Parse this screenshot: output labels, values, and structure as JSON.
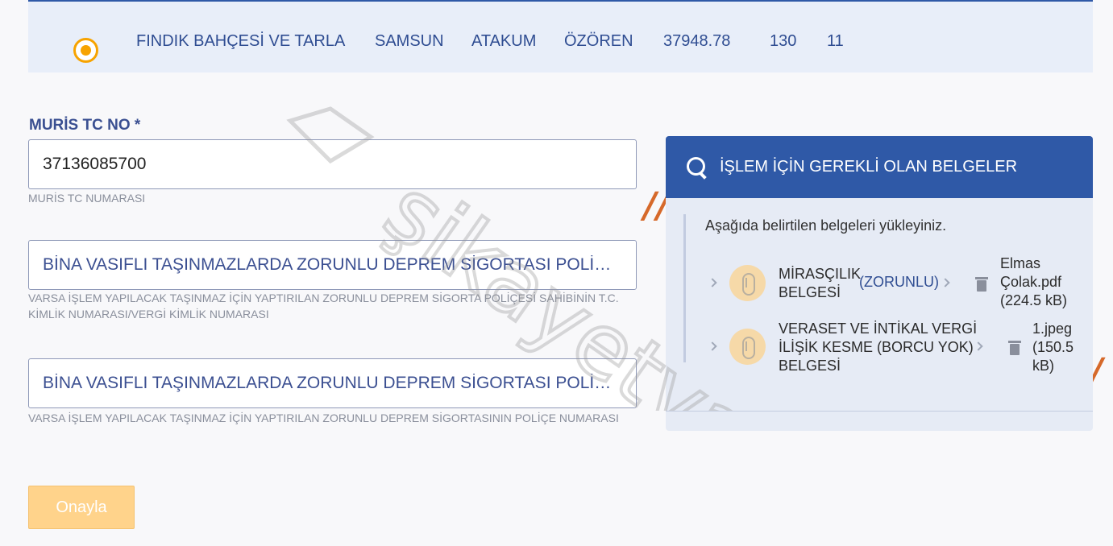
{
  "property_row": {
    "cells": [
      "FINDIK BAHÇESİ VE TARLA",
      "SAMSUN",
      "ATAKUM",
      "ÖZÖREN",
      "37948.78",
      "130",
      "11"
    ]
  },
  "fields": {
    "muris_label": "MURİS TC NO *",
    "muris_value": "37136085700",
    "muris_help": "MURİS TC NUMARASI",
    "deprem_id_placeholder": "BİNA VASIFLI TAŞINMAZLARDA ZORUNLU DEPREM SİGORTASI POLİÇE...",
    "deprem_id_help": "VARSA İŞLEM YAPILACAK TAŞINMAZ İÇİN YAPTIRILAN ZORUNLU DEPREM SİGORTA POLİÇESİ SAHİBİNİN T.C. KİMLİK NUMARASI/VERGİ KİMLİK NUMARASI",
    "deprem_no_placeholder": "BİNA VASIFLI TAŞINMAZLARDA ZORUNLU DEPREM SİGORTASI POLİÇE...",
    "deprem_no_help": "VARSA İŞLEM YAPILACAK TAŞINMAZ İÇİN YAPTIRILAN ZORUNLU DEPREM SİGORTASININ POLİÇE NUMARASI"
  },
  "actions": {
    "confirm_label": "Onayla"
  },
  "documents": {
    "title": "İŞLEM İÇİN GEREKLİ OLAN BELGELER",
    "instruction": "Aşağıda belirtilen belgeleri yükleyiniz.",
    "items": [
      {
        "name_line1": "MİRASÇILIK",
        "name_line2": "BELGESİ",
        "badge": "(ZORUNLU)",
        "file_line1": "Elmas",
        "file_line2": "Çolak.pdf",
        "file_line3": "(224.5 kB)"
      },
      {
        "name_line1": "VERASET VE İNTİKAL VERGİ",
        "name_line2": "İLİŞİK KESME (BORCU YOK)",
        "name_line3": "BELGESİ",
        "file_line1": "1.jpeg",
        "file_line2": "(150.5",
        "file_line3": "kB)"
      }
    ]
  },
  "watermark": "şikayetvar",
  "colors": {
    "primary": "#2f59a7",
    "accent": "#f7a300",
    "button_disabled": "#ffd38b"
  }
}
